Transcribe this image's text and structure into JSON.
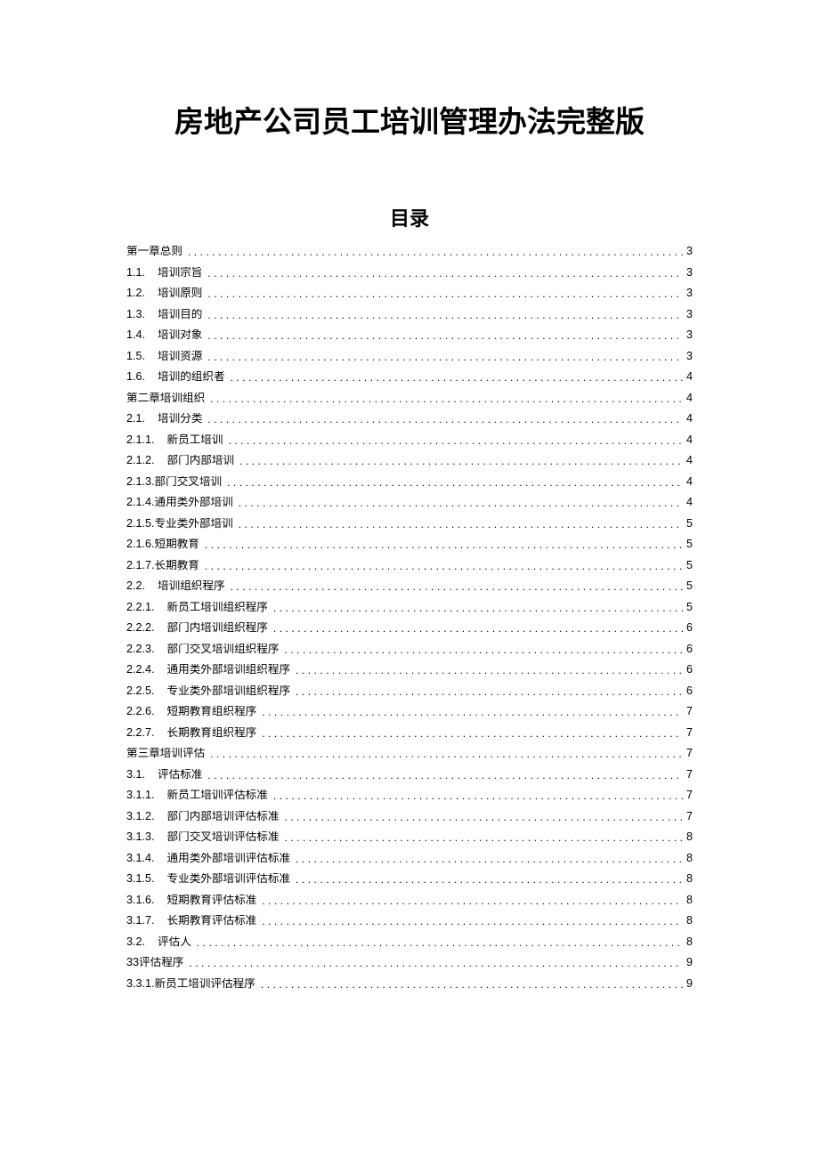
{
  "title": "房地产公司员工培训管理办法完整版",
  "toc_heading": "目录",
  "toc": [
    {
      "num": "",
      "label": "第一章总则",
      "page": "3",
      "indent": 0
    },
    {
      "num": "1.1.",
      "label": "培训宗旨",
      "page": "3",
      "indent": 1
    },
    {
      "num": "1.2.",
      "label": "培训原则",
      "page": "3",
      "indent": 1
    },
    {
      "num": "1.3.",
      "label": "培训目的",
      "page": "3",
      "indent": 1
    },
    {
      "num": "1.4.",
      "label": "培训对象",
      "page": "3",
      "indent": 1
    },
    {
      "num": "1.5.",
      "label": "培训资源",
      "page": "3",
      "indent": 1
    },
    {
      "num": "1.6.",
      "label": "培训的组织者",
      "page": "4",
      "indent": 1
    },
    {
      "num": "",
      "label": "第二章培训组织",
      "page": "4",
      "indent": 0
    },
    {
      "num": "2.1.",
      "label": "培训分类",
      "page": "4",
      "indent": 1
    },
    {
      "num": "2.1.1.",
      "label": "新员工培训",
      "page": "4",
      "indent": 2
    },
    {
      "num": "2.1.2.",
      "label": "部门内部培训",
      "page": "4",
      "indent": 2
    },
    {
      "num": "2.1.3.",
      "label": "部门交叉培训",
      "page": "4",
      "indent": 2,
      "tight": true
    },
    {
      "num": "2.1.4.",
      "label": "通用类外部培训",
      "page": "4",
      "indent": 2,
      "tight": true
    },
    {
      "num": "2.1.5.",
      "label": "专业类外部培训",
      "page": "5",
      "indent": 2,
      "tight": true
    },
    {
      "num": "2.1.6.",
      "label": "短期教育",
      "page": "5",
      "indent": 2,
      "tight": true
    },
    {
      "num": "2.1.7.",
      "label": "长期教育",
      "page": "5",
      "indent": 2,
      "tight": true
    },
    {
      "num": "2.2.",
      "label": "培训组织程序",
      "page": "5",
      "indent": 1
    },
    {
      "num": "2.2.1.",
      "label": "新员工培训组织程序",
      "page": "5",
      "indent": 2
    },
    {
      "num": "2.2.2.",
      "label": "部门内培训组织程序",
      "page": "6",
      "indent": 2
    },
    {
      "num": "2.2.3.",
      "label": "部门交叉培训组织程序",
      "page": "6",
      "indent": 2
    },
    {
      "num": "2.2.4.",
      "label": "通用类外部培训组织程序",
      "page": "6",
      "indent": 2
    },
    {
      "num": "2.2.5.",
      "label": "专业类外部培训组织程序",
      "page": "6",
      "indent": 2
    },
    {
      "num": "2.2.6.",
      "label": "短期教育组织程序",
      "page": "7",
      "indent": 2
    },
    {
      "num": "2.2.7.",
      "label": "长期教育组织程序",
      "page": "7",
      "indent": 2
    },
    {
      "num": "",
      "label": "第三章培训评估",
      "page": "7",
      "indent": 0
    },
    {
      "num": "3.1.",
      "label": "评估标准",
      "page": "7",
      "indent": 1
    },
    {
      "num": "3.1.1.",
      "label": "新员工培训评估标准",
      "page": "7",
      "indent": 2
    },
    {
      "num": "3.1.2.",
      "label": "部门内部培训评估标准",
      "page": "7",
      "indent": 2
    },
    {
      "num": "3.1.3.",
      "label": "部门交叉培训评估标准",
      "page": "8",
      "indent": 2
    },
    {
      "num": "3.1.4.",
      "label": "通用类外部培训评估标准",
      "page": "8",
      "indent": 2
    },
    {
      "num": "3.1.5.",
      "label": "专业类外部培训评估标准",
      "page": "8",
      "indent": 2
    },
    {
      "num": "3.1.6.",
      "label": "短期教育评估标准",
      "page": "8",
      "indent": 2
    },
    {
      "num": "3.1.7.",
      "label": "长期教育评估标准",
      "page": "8",
      "indent": 2
    },
    {
      "num": "3.2.",
      "label": "评估人",
      "page": "8",
      "indent": 1
    },
    {
      "num": "33",
      "label": "评估程序",
      "page": "9",
      "indent": 0,
      "tight": true
    },
    {
      "num": "3.3.1.",
      "label": "新员工培训评估程序",
      "page": "9",
      "indent": 2,
      "tight": true
    }
  ]
}
